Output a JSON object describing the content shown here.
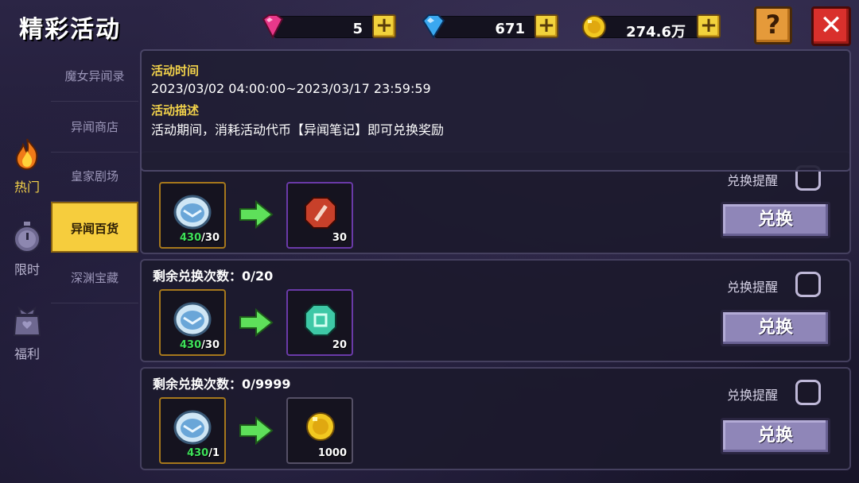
{
  "header": {
    "title": "精彩活动",
    "currencies": [
      {
        "name": "pink-gem",
        "value": "5",
        "color": "#e8388a"
      },
      {
        "name": "blue-gem",
        "value": "671",
        "color": "#3aa8f0"
      },
      {
        "name": "gold-coin",
        "value": "274.6万",
        "color": "#f2c820"
      }
    ],
    "plus_label": "+",
    "help_label": "?",
    "close_label": "✕"
  },
  "categories": [
    {
      "label": "热门",
      "icon": "fire-icon",
      "active": true
    },
    {
      "label": "限时",
      "icon": "stopwatch-icon",
      "active": false
    },
    {
      "label": "福利",
      "icon": "gift-bag-icon",
      "active": false
    }
  ],
  "subtabs": [
    {
      "label": "魔女异闻录"
    },
    {
      "label": "异闻商店"
    },
    {
      "label": "皇家剧场"
    },
    {
      "label": "异闻百货"
    },
    {
      "label": "深渊宝藏"
    }
  ],
  "info": {
    "time_heading": "活动时间",
    "time_value": "2023/03/02 04:00:00~2023/03/17 23:59:59",
    "desc_heading": "活动描述",
    "desc_value": "活动期间，消耗活动代币【异闻笔记】即可兑换奖励"
  },
  "rows": [
    {
      "remaining": "",
      "reminder": "兑换提醒",
      "cost_have": "430",
      "cost_need": "/30",
      "reward_amount": "30",
      "reward_icon": "red-rune-icon",
      "button": "兑换"
    },
    {
      "remaining": "剩余兑换次数：0/20",
      "reminder": "兑换提醒",
      "cost_have": "430",
      "cost_need": "/30",
      "reward_amount": "20",
      "reward_icon": "teal-rune-icon",
      "button": "兑换"
    },
    {
      "remaining": "剩余兑换次数：0/9999",
      "reminder": "兑换提醒",
      "cost_have": "430",
      "cost_need": "/1",
      "reward_amount": "1000",
      "reward_icon": "gold-coin-icon",
      "button": "兑换"
    }
  ]
}
